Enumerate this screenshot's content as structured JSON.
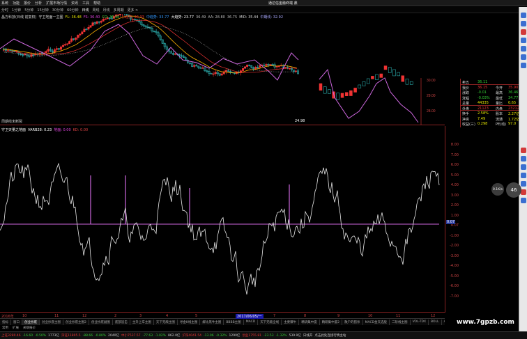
{
  "menubar": {
    "items": [
      "系统",
      "功能",
      "报价",
      "分析",
      "扩展市场行情",
      "资讯",
      "工具",
      "帮助"
    ],
    "window_name": "通达信金融终端 鼎"
  },
  "periodbar": {
    "items": [
      "分时",
      "1分钟",
      "5分钟",
      "15分钟",
      "30分钟",
      "60分钟",
      "日线",
      "周线",
      "月线",
      "多周期",
      "更多 >"
    ]
  },
  "main_legend": {
    "items": [
      {
        "text": "晶方科技(日线 前复权)",
        "color": "#dddddd"
      },
      {
        "text": "守卫地面一主图",
        "color": "#dddddd"
      },
      {
        "text": "FL: 36.48",
        "color": "#e6e600"
      },
      {
        "text": "FS: 36.40",
        "color": "#dd44dd"
      },
      {
        "text": "CO: 36.40",
        "color": "#44dd44"
      },
      {
        "text": "小趋势: 36.33",
        "color": "#ee3333"
      },
      {
        "text": "中趋势: 33.77",
        "color": "#3399ff"
      },
      {
        "text": "大趋势: 23.77",
        "color": "#ffffff"
      },
      {
        "text": "36.49",
        "color": "#bbbbbb"
      },
      {
        "text": "AA: 28.80",
        "color": "#bbbbbb"
      },
      {
        "text": "36.75",
        "color": "#bbbbbb"
      },
      {
        "text": "MID: 35.44",
        "color": "#dddddd"
      },
      {
        "text": "中期线: 32.92",
        "color": "#aaaaff"
      }
    ],
    "bottom_label": "周期线未断裂",
    "low_price": "24.98"
  },
  "sub_legend": {
    "items": [
      {
        "text": "守卫天量之地面",
        "color": "#ffffff"
      },
      {
        "text": "VARB28: 0.23",
        "color": "#ffffff"
      },
      {
        "text": "地面: 0.00",
        "color": "#dd44dd"
      },
      {
        "text": "KD: 0.00",
        "color": "#dd4444"
      }
    ]
  },
  "right_axis": {
    "ticks": [
      "8.00",
      "7.00",
      "6.00",
      "5.00",
      "4.00",
      "3.00",
      "2.00",
      "1.00",
      "0.07",
      "-1.00",
      "-2.00",
      "-3.00",
      "-4.00",
      "-5.00",
      "-6.00",
      "-7.00"
    ],
    "current_tag": "0.07"
  },
  "dates": [
    {
      "text": "2016年",
      "hl": false
    },
    {
      "text": "10",
      "hl": false
    },
    {
      "text": "11",
      "hl": false
    },
    {
      "text": "12",
      "hl": false
    },
    {
      "text": "2",
      "hl": false
    },
    {
      "text": "3",
      "hl": false
    },
    {
      "text": "4",
      "hl": false
    },
    {
      "text": "5",
      "hl": false
    },
    {
      "text": "2017/06/05/一",
      "hl": true
    },
    {
      "text": "7",
      "hl": false
    },
    {
      "text": "8",
      "hl": false
    },
    {
      "text": "9",
      "hl": false
    },
    {
      "text": "10",
      "hl": false
    },
    {
      "text": "11",
      "hl": false
    },
    {
      "text": "12",
      "hl": false
    }
  ],
  "tabs": [
    "指标",
    "窗口",
    "创业抄底",
    "创业抄底主图",
    "创业抄底主图2",
    "创业抄底副图",
    "底部追击",
    "主升上车主图",
    "天下无敌主图",
    "寻金K线主图",
    "解比黑牛主图",
    "BBBB主图",
    "MACD",
    "天下无敌全线",
    "主要赚牛",
    "精研集中度",
    "精研集中度2",
    "散户的猎杀",
    "MACD金叉选股",
    "二阶线主图",
    "VOL-TDX",
    "BOLL",
    "AAAAA"
  ],
  "tabs2": [
    "常用",
    "扩展",
    "关联报价"
  ],
  "status": [
    {
      "text": "上证3280.46",
      "color": "#ee3333"
    },
    {
      "text": "-16.60",
      "color": "#33cc33"
    },
    {
      "text": "-0.50%",
      "color": "#33cc33"
    },
    {
      "text": "1773亿",
      "color": "#cccccc"
    },
    {
      "text": "深证11805.5",
      "color": "#ee3333"
    },
    {
      "text": "-88.66",
      "color": "#33cc33"
    },
    {
      "text": "-0.80%",
      "color": "#33cc33"
    },
    {
      "text": "2040亿",
      "color": "#cccccc"
    },
    {
      "text": "中小7537.57",
      "color": "#ee3333"
    },
    {
      "text": "-77.63",
      "color": "#33cc33"
    },
    {
      "text": "-1.02%",
      "color": "#33cc33"
    },
    {
      "text": "862.0亿",
      "color": "#cccccc"
    },
    {
      "text": "沪深4041.54",
      "color": "#ee3333"
    },
    {
      "text": "-13.06",
      "color": "#33cc33"
    },
    {
      "text": "-0.32%",
      "color": "#33cc33"
    },
    {
      "text": "1290亿",
      "color": "#cccccc"
    },
    {
      "text": "创业1755.81",
      "color": "#ee3333"
    },
    {
      "text": "-23.53",
      "color": "#33cc33"
    },
    {
      "text": "-1.32%",
      "color": "#33cc33"
    },
    {
      "text": "539.9亿",
      "color": "#cccccc"
    },
    {
      "text": "日线开",
      "color": "#cccccc"
    },
    {
      "text": "点击此处连接行情主站",
      "color": "#cccccc"
    }
  ],
  "quote": {
    "rows": [
      {
        "l": "卖五",
        "v": "36.11",
        "v2": "",
        "r": "",
        "c": "#33cc33"
      },
      {
        "l": "我价",
        "v": "36.15",
        "v2": "今开",
        "r": "35.90",
        "c": "#ee3333"
      },
      {
        "l": "涨跌",
        "v": "-0.01",
        "v2": "最高",
        "r": "36.46",
        "c": "#33cc33"
      },
      {
        "l": "涨幅",
        "v": "-0.03%",
        "v2": "最低",
        "r": "34.77",
        "c": "#33cc33"
      },
      {
        "l": "总量",
        "v": "44335",
        "v2": "量比",
        "r": "0.65",
        "c": "#e6e600"
      },
      {
        "l": "外盘",
        "v": "21123",
        "v2": "内盘",
        "r": "23212",
        "c": "#ee3333"
      },
      {
        "l": "换手",
        "v": "2.58%",
        "v2": "股本",
        "r": "2.27亿",
        "c": "#e6e600"
      },
      {
        "l": "净资",
        "v": "7.49",
        "v2": "流通",
        "r": "1.72亿",
        "c": "#e6e600"
      },
      {
        "l": "收益(三)",
        "v": "0.298",
        "v2": "PE(动)",
        "r": "97.0",
        "c": "#e6e600"
      }
    ],
    "price_ticks": [
      "30.00",
      "29.00",
      "28.00"
    ]
  },
  "floating": {
    "button_label": "0.1K/s",
    "bubble": "46"
  },
  "watermark": "www.7gpzb.com",
  "colors": {
    "up": "#ee3333",
    "down": "#33cccc",
    "purple": "#cc66dd",
    "white": "#e8e8e8"
  }
}
